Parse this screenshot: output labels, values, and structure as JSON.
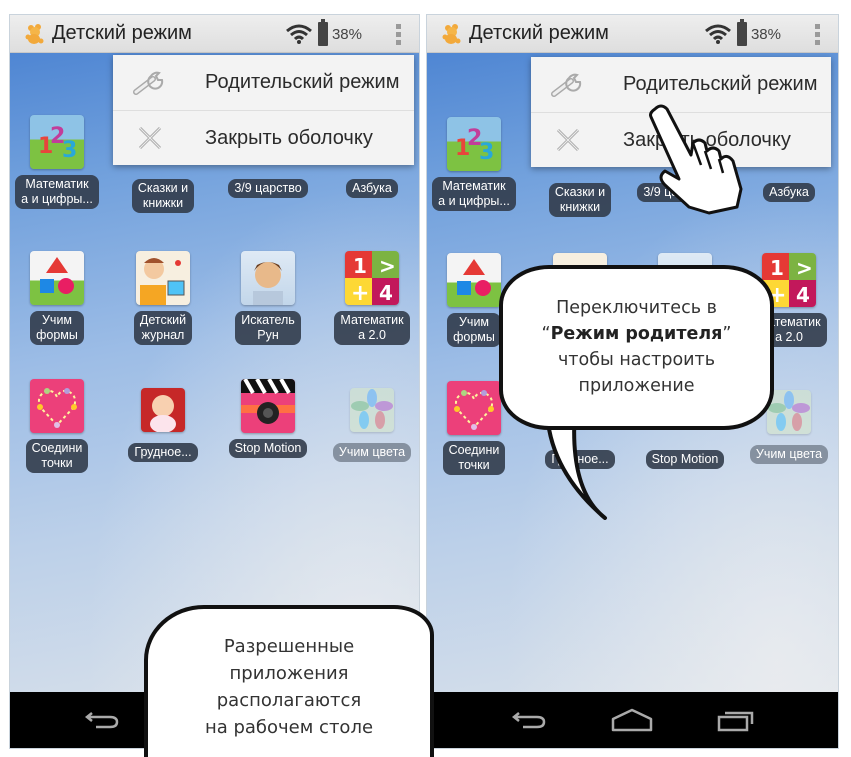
{
  "statusbar": {
    "title": "Детский режим",
    "battery": "38%",
    "icons": [
      "bear-logo-icon",
      "wifi-icon",
      "battery-icon",
      "overflow-menu-icon"
    ]
  },
  "menu": {
    "items": [
      {
        "label": "Родительский режим",
        "icon": "wrench-icon"
      },
      {
        "label": "Закрыть оболочку",
        "icon": "close-x-icon"
      }
    ]
  },
  "apps": [
    {
      "label": "Математик\nа и цифры...",
      "icon": "numbers-123-icon"
    },
    {
      "label": "Сказки и\nкнижки",
      "icon": "books-icon"
    },
    {
      "label": "3/9 царство",
      "icon": "kingdom-icon"
    },
    {
      "label": "Азбука",
      "icon": "alphabet-icon"
    },
    {
      "label": "Учим\nформы",
      "icon": "shapes-icon"
    },
    {
      "label": "Детский\nжурнал",
      "icon": "kids-journal-icon"
    },
    {
      "label": "Искатель\nРун",
      "icon": "rune-seeker-icon"
    },
    {
      "label": "Математик\nа 2.0",
      "icon": "math-2-icon"
    },
    {
      "label": "Соедини\nточки",
      "icon": "connect-dots-icon"
    },
    {
      "label": "Грудное...",
      "icon": "baby-icon"
    },
    {
      "label": "Stop Motion",
      "icon": "clapperboard-camera-icon"
    },
    {
      "label": "Учим цвета",
      "icon": "color-petals-icon"
    }
  ],
  "navbar": {
    "left_buttons": [
      "back"
    ],
    "right_buttons": [
      "back",
      "home",
      "recent-apps"
    ]
  },
  "callouts": {
    "bottom_left": {
      "lines": [
        "Разрешенные",
        "приложения",
        "располагаются",
        "на рабочем столе"
      ]
    },
    "center_right": {
      "line1": "Переключитесь в",
      "line2_quote_open": "“",
      "line2_bold": "Режим родителя",
      "line2_quote_close": "”",
      "line3": "чтобы настроить",
      "line4": "приложение"
    }
  },
  "colors": {
    "statusbar_bg": "#e6e6e6",
    "wallpaper_top": "#4f86d3",
    "wallpaper_bottom": "#d9e1ea",
    "label_bg": "#323c4b",
    "menu_bg": "#f3f3f3",
    "navbar_bg": "#000000"
  }
}
